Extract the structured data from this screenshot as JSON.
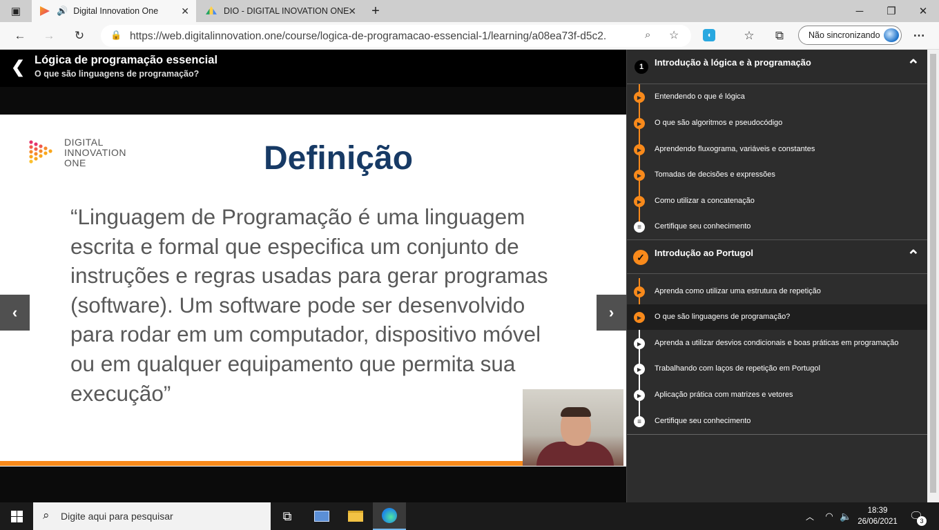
{
  "browser": {
    "tabs": [
      {
        "title": "Digital Innovation One",
        "active": true
      },
      {
        "title": "DIO - DIGITAL INOVATION ONE -",
        "active": false
      }
    ],
    "url": "https://web.digitalinnovation.one/course/logica-de-programacao-essencial-1/learning/a08ea73f-d5c2...",
    "profile_label": "Não sincronizando"
  },
  "course": {
    "title": "Lógica de programação essencial",
    "lesson": "O que são linguagens de programação?"
  },
  "slide": {
    "logo_lines": [
      "DIGITAL",
      "INNOVATION",
      "ONE"
    ],
    "title": "Definição",
    "quote": "“Linguagem de Programação é uma linguagem escrita e formal que especifica um conjunto de instruções e regras usadas para gerar programas (software). Um software pode ser desenvolvido para rodar em um computador, dispositivo móvel ou em qualquer equipamento que permita sua execução”"
  },
  "sidebar": {
    "sections": [
      {
        "number": "1",
        "title": "Introdução à lógica e à programação",
        "lessons": [
          {
            "label": "Entendendo o que é lógica",
            "icon": "play-orange"
          },
          {
            "label": "O que são algoritmos e pseudocódigo",
            "icon": "play-orange"
          },
          {
            "label": "Aprendendo fluxograma, variáveis e constantes",
            "icon": "play-orange"
          },
          {
            "label": "Tomadas de decisões e expressões",
            "icon": "play-orange"
          },
          {
            "label": "Como utilizar a concatenação",
            "icon": "play-orange"
          },
          {
            "label": "Certifique seu conhecimento",
            "icon": "quiz-list"
          }
        ]
      },
      {
        "number": "",
        "title": "Introdução ao Portugol",
        "lessons": [
          {
            "label": "Aprenda como utilizar uma estrutura de repetição",
            "icon": "play-orange"
          },
          {
            "label": "O que são linguagens de programação?",
            "icon": "play-orange",
            "current": true
          },
          {
            "label": "Aprenda a utilizar desvios condicionais e boas práticas em programação",
            "icon": "play-white"
          },
          {
            "label": "Trabalhando com laços de repetição em Portugol",
            "icon": "play-white"
          },
          {
            "label": "Aplicação prática com matrizes e vetores",
            "icon": "play-white"
          },
          {
            "label": "Certifique seu conhecimento",
            "icon": "quiz-list"
          }
        ]
      }
    ]
  },
  "taskbar": {
    "search_placeholder": "Digite aqui para pesquisar",
    "time": "18:39",
    "date": "26/06/2021",
    "notifications": "3"
  },
  "colors": {
    "accent_orange": "#f98a1b",
    "slide_title": "#173a65",
    "sidebar_bg": "#2d2d2d"
  }
}
